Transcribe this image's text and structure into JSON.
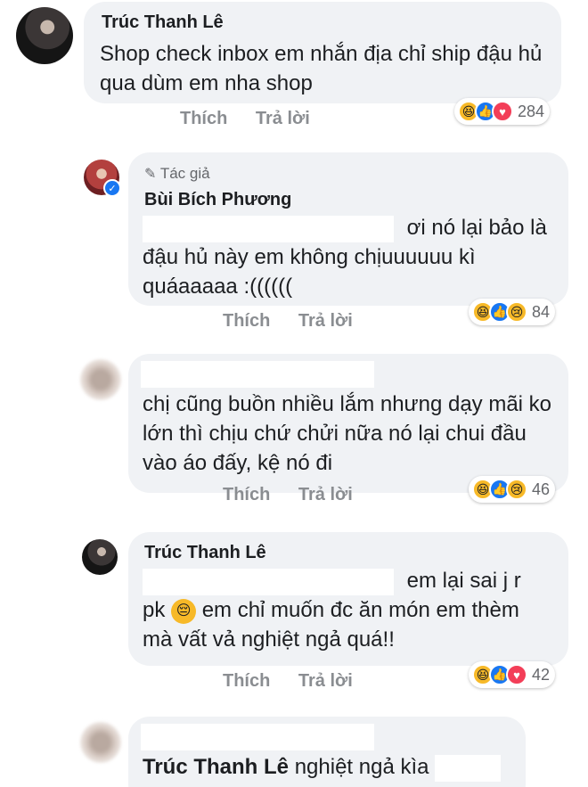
{
  "comments": [
    {
      "author": "Trúc Thanh Lê",
      "text": "Shop check inbox em nhắn địa chỉ ship đậu hủ qua dùm em nha shop",
      "actions": {
        "like": "Thích",
        "reply": "Trả lời"
      },
      "reactions": {
        "icons": [
          "haha",
          "like",
          "love"
        ],
        "count": "284"
      }
    },
    {
      "badge": "Tác giả",
      "author": "Bùi Bích Phương",
      "text_line1_tail": "ơi nó lại bảo là",
      "text_rest": "đậu hủ này em không chịuuuuuu kì quáaaaaa :((((((",
      "actions": {
        "like": "Thích",
        "reply": "Trả lời"
      },
      "reactions": {
        "icons": [
          "haha",
          "like",
          "sad"
        ],
        "count": "84"
      }
    },
    {
      "text": "chị cũng buồn nhiều lắm nhưng dạy mãi ko lớn thì chịu chứ chửi nữa nó lại chui đầu vào áo đấy, kệ nó đi",
      "actions": {
        "like": "Thích",
        "reply": "Trả lời"
      },
      "reactions": {
        "icons": [
          "haha",
          "like",
          "sad"
        ],
        "count": "46"
      }
    },
    {
      "author": "Trúc Thanh Lê",
      "text_line1_tail": "em lại sai j r",
      "text_line2_pre": "pk",
      "text_line2_post": "em chỉ muốn đc ăn món em thèm",
      "text_line3": "mà vất vả nghiệt ngả quá!!",
      "actions": {
        "like": "Thích",
        "reply": "Trả lời"
      },
      "reactions": {
        "icons": [
          "haha",
          "like",
          "love"
        ],
        "count": "42"
      }
    },
    {
      "mention": "Trúc Thanh Lê",
      "text_tail": "nghiệt ngả kìa"
    }
  ],
  "colors": {
    "bubble": "#f0f2f5",
    "action_text": "#8a8d91",
    "like_blue": "#1877f2",
    "love_red": "#f33e58",
    "haha_yellow": "#f7b928"
  }
}
